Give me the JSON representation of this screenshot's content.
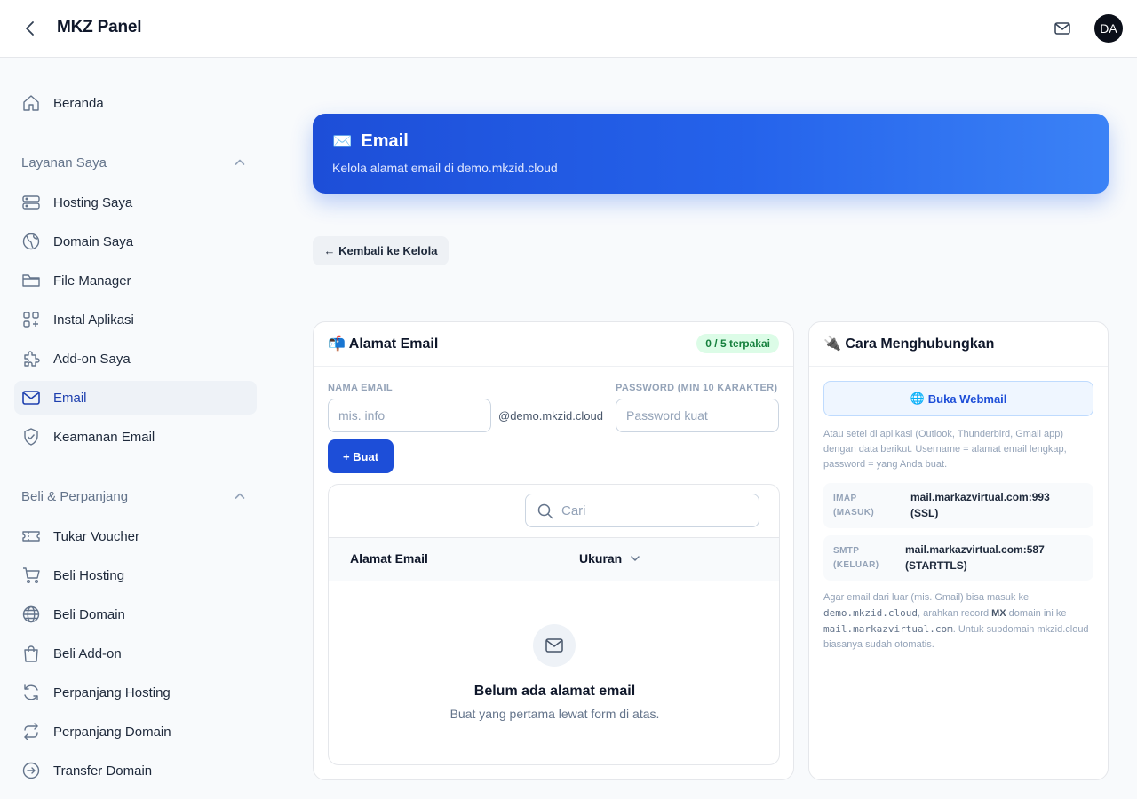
{
  "header": {
    "title": "MKZ Panel",
    "avatar_initials": "DA"
  },
  "sidebar": {
    "home": "Beranda",
    "sections": [
      {
        "title": "Layanan Saya",
        "items": [
          "Hosting Saya",
          "Domain Saya",
          "File Manager",
          "Instal Aplikasi",
          "Add-on Saya",
          "Email",
          "Keamanan Email"
        ]
      },
      {
        "title": "Beli & Perpanjang",
        "items": [
          "Tukar Voucher",
          "Beli Hosting",
          "Beli Domain",
          "Beli Add-on",
          "Perpanjang Hosting",
          "Perpanjang Domain",
          "Transfer Domain"
        ]
      }
    ],
    "active_item": "Email"
  },
  "hero": {
    "icon": "✉️",
    "title": "Email",
    "subtitle": "Kelola alamat email di demo.mkzid.cloud"
  },
  "back_link": "← Kembali ke Kelola",
  "email_card": {
    "icon": "📬",
    "title": "Alamat Email",
    "usage_badge": "0 / 5 terpakai",
    "name_label": "NAMA EMAIL",
    "name_placeholder": "mis. info",
    "domain_suffix": "@demo.mkzid.cloud",
    "password_label": "PASSWORD (MIN 10 KARAKTER)",
    "password_placeholder": "Password kuat",
    "create_button": "+ Buat",
    "search_placeholder": "Cari",
    "columns": [
      "Alamat Email",
      "Ukuran"
    ],
    "empty_title": "Belum ada alamat email",
    "empty_subtitle": "Buat yang pertama lewat form di atas."
  },
  "connect_card": {
    "icon": "🔌",
    "title": "Cara Menghubungkan",
    "webmail_icon": "🌐",
    "webmail_button": "Buka Webmail",
    "instructions": "Atau setel di aplikasi (Outlook, Thunderbird, Gmail app) dengan data berikut. Username = alamat email lengkap, password = yang Anda buat.",
    "servers": [
      {
        "label_line1": "IMAP",
        "label_line2": "(MASUK)",
        "value_line1": "mail.markazvirtual.com:993",
        "value_line2": "(SSL)"
      },
      {
        "label_line1": "SMTP",
        "label_line2": "(KELUAR)",
        "value_line1": "mail.markazvirtual.com:587",
        "value_line2": "(STARTTLS)"
      }
    ],
    "mx_note": {
      "part1": "Agar email dari luar (mis. Gmail) bisa masuk ke ",
      "code1": "demo.mkzid.cloud",
      "part2": ", arahkan record ",
      "bold": "MX",
      "part3": " domain ini ke ",
      "code2": "mail.markazvirtual.com",
      "part4": ". Untuk subdomain mkzid.cloud biasanya sudah otomatis."
    }
  },
  "colors": {
    "accent": "#1d4ed8",
    "badge_bg": "#dcfce7",
    "badge_text": "#15803d"
  }
}
